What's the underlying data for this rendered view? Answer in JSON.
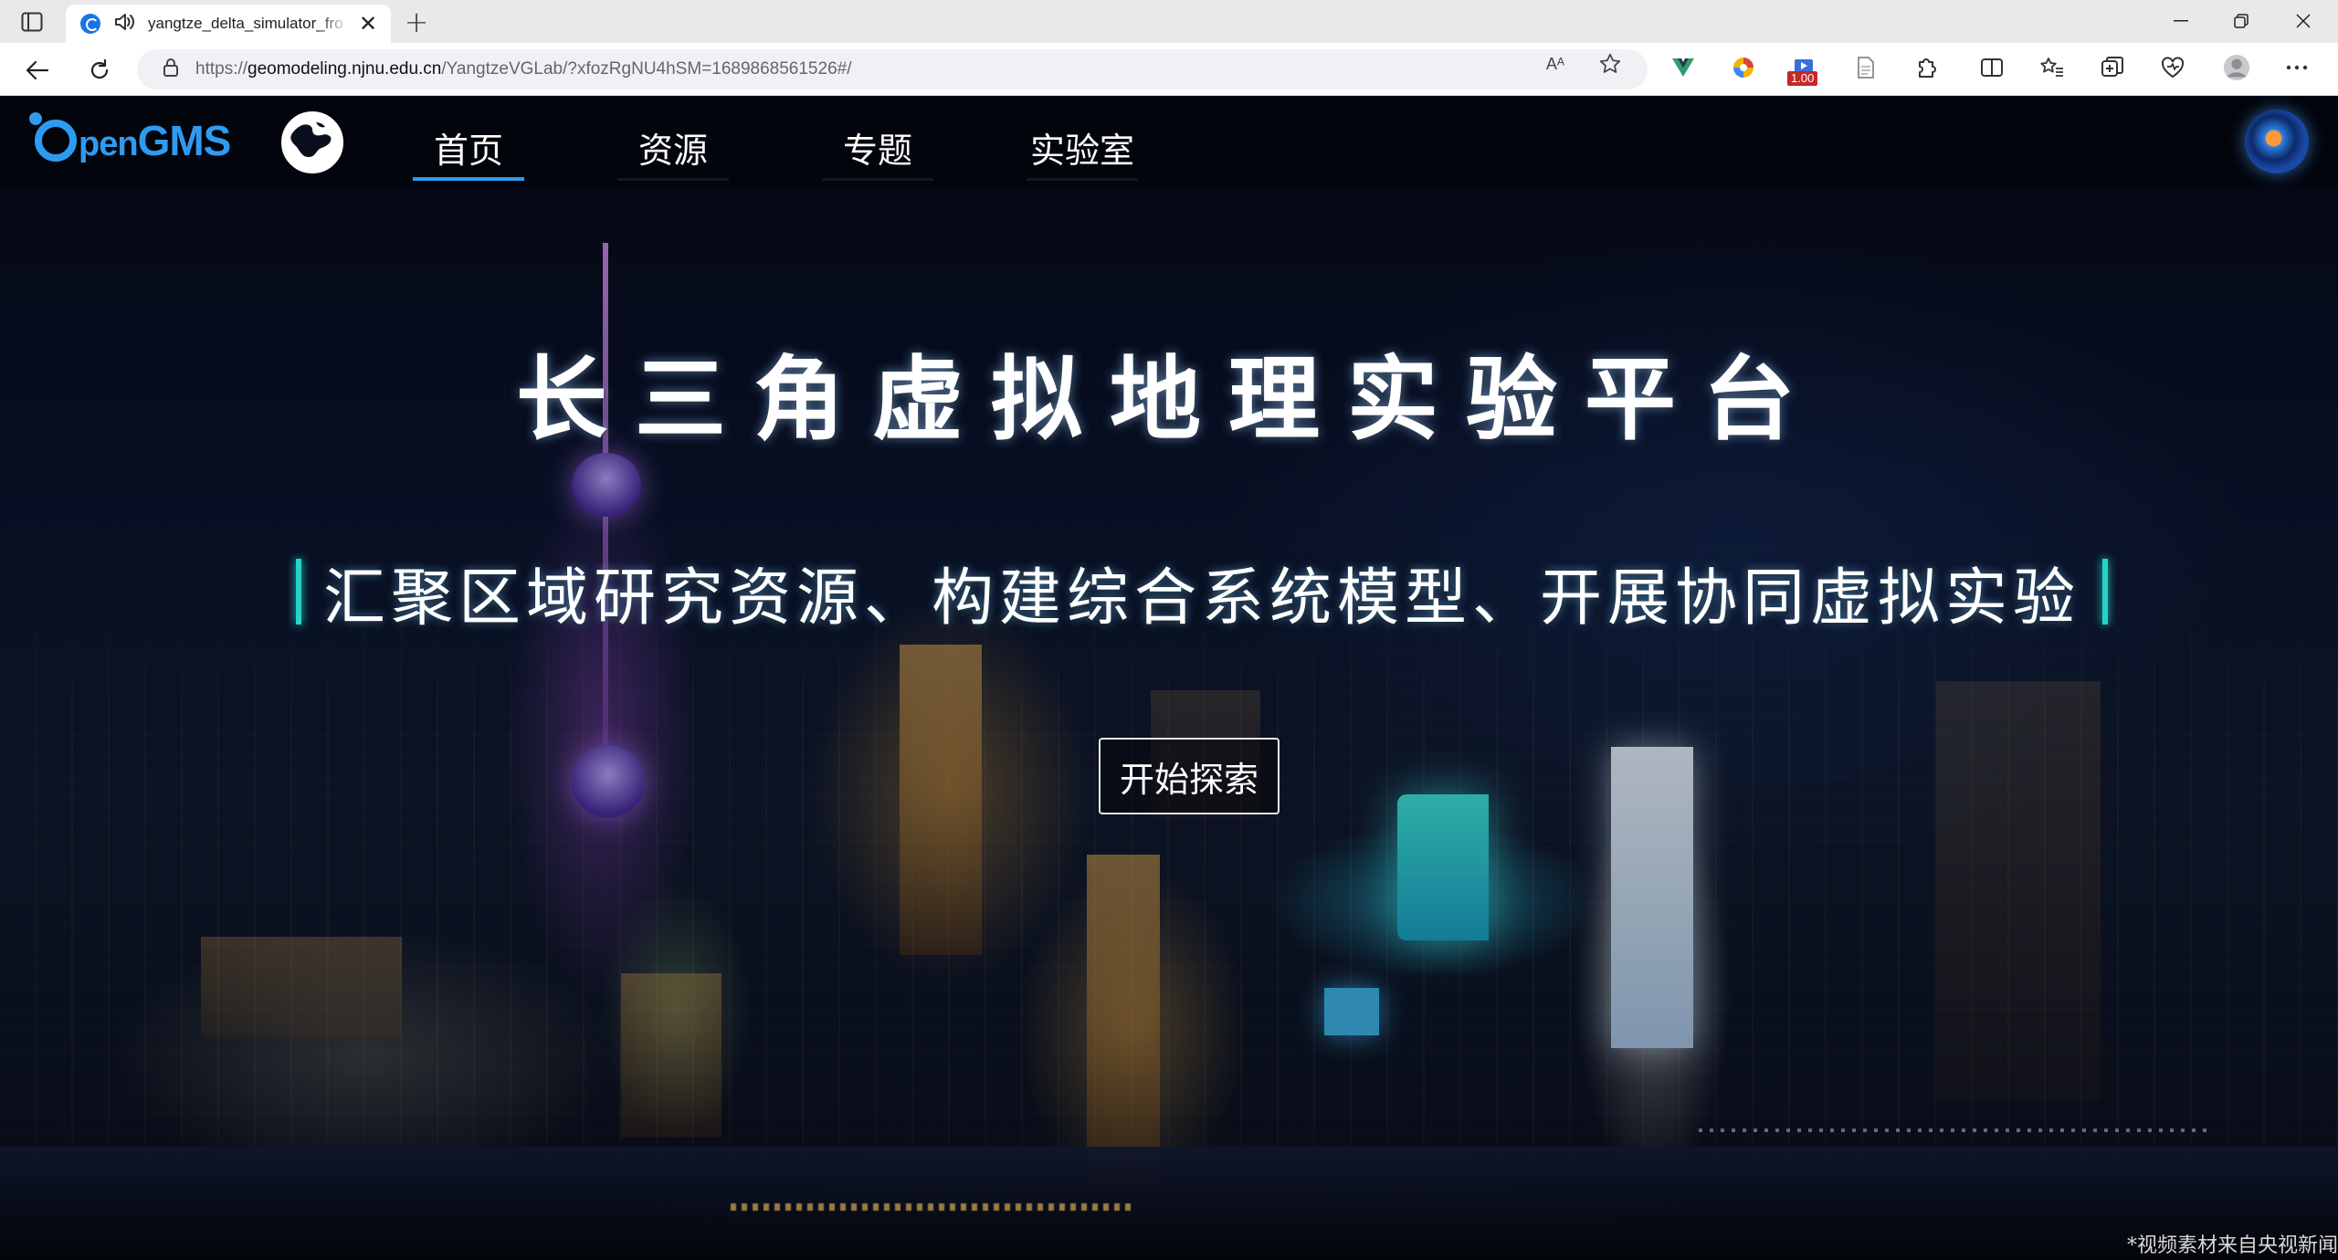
{
  "browser": {
    "tab": {
      "title": "yangtze_delta_simulator_fro"
    },
    "address": {
      "scheme": "https://",
      "host": "geomodeling.njnu.edu.cn",
      "path": "/YangtzeVGLab/?xfozRgNU4hSM=1689868561526#/"
    },
    "read_aloud_label": "Aᴬ",
    "extension_badge": "1.00"
  },
  "site": {
    "logo_o": "",
    "logo_pen": "pen",
    "logo_gms": "GMS",
    "nav": [
      "首页",
      "资源",
      "专题",
      "实验室"
    ],
    "active_nav": "首页"
  },
  "hero": {
    "title": "长三角虚拟地理实验平台",
    "subtitle": "汇聚区域研究资源、构建综合系统模型、开展协同虚拟实验",
    "button": "开始探索",
    "credit": "*视频素材来自央视新闻"
  },
  "colors": {
    "accent": "#2f9bf0",
    "subtitle_bar": "#27d3c8"
  }
}
